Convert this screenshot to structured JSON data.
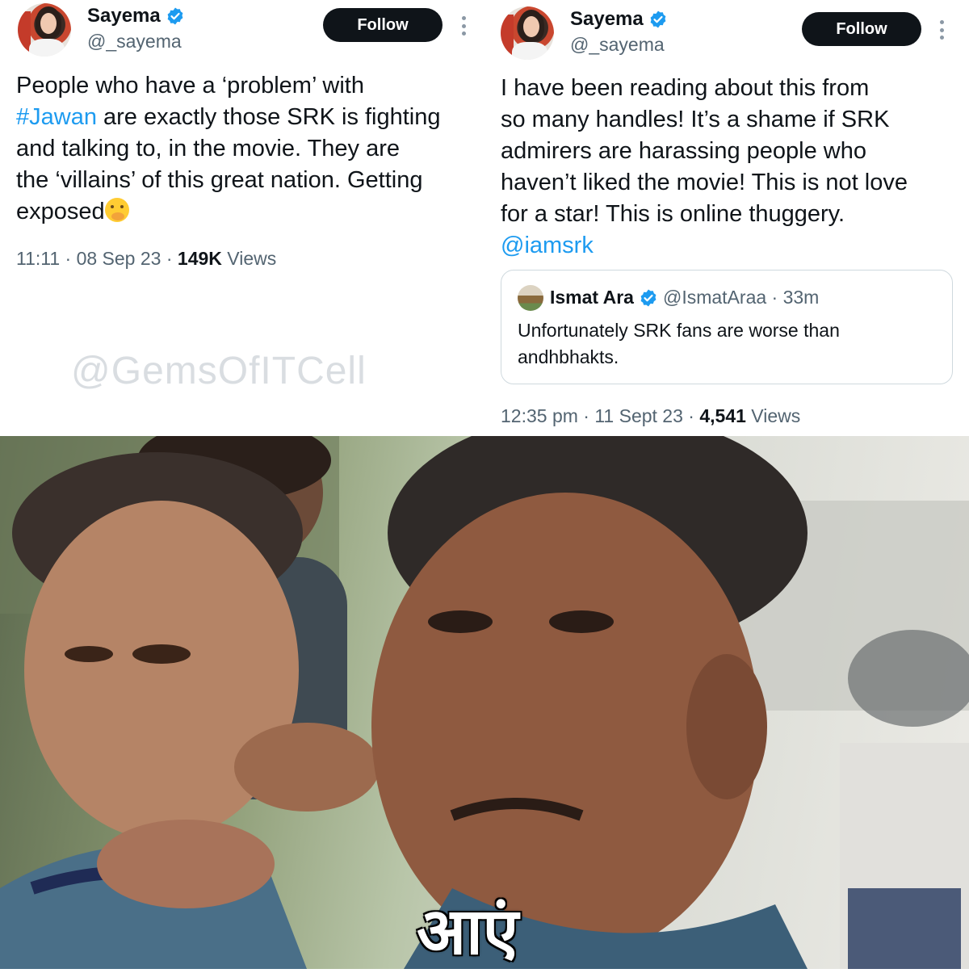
{
  "left_tweet": {
    "name": "Sayema",
    "handle": "@_sayema",
    "follow_label": "Follow",
    "text_line1": "People who have a ‘problem’ with",
    "hashtag": "#Jawan",
    "text_line2_rest": " are exactly those SRK is fighting",
    "text_line3": "and talking to, in the movie. They are",
    "text_line4": "the ‘villains’ of this great nation. Getting",
    "text_line5": "exposed",
    "emoji_icon": "hand-over-mouth-emoji",
    "time": "11:11 · 08 Sep 23 · ",
    "views_count": "149K",
    "views_label": " Views"
  },
  "right_tweet": {
    "name": "Sayema",
    "handle": "@_sayema",
    "follow_label": "Follow",
    "text_line1": "I have been reading about this from",
    "text_line2": "so many handles! It’s a shame if SRK",
    "text_line3": "admirers are harassing people who",
    "text_line4": "haven’t liked the movie! This is not love",
    "text_line5": "for a star! This is online thuggery.",
    "mention": "@iamsrk",
    "quote": {
      "name": "Ismat Ara",
      "handle_time": "@IsmatAraa · 33m",
      "text_line1": "Unfortunately SRK fans are worse than",
      "text_line2": "andhbhakts."
    },
    "time": "12:35 pm · 11 Sept 23 · ",
    "views_count": "4,541",
    "views_label": " Views"
  },
  "watermark": "@GemsOfITCell",
  "meme_caption": "आएं",
  "colors": {
    "link": "#1d9bf0",
    "verified": "#1d9bf0",
    "follow_bg": "#0f1419",
    "secondary_text": "#536471"
  }
}
